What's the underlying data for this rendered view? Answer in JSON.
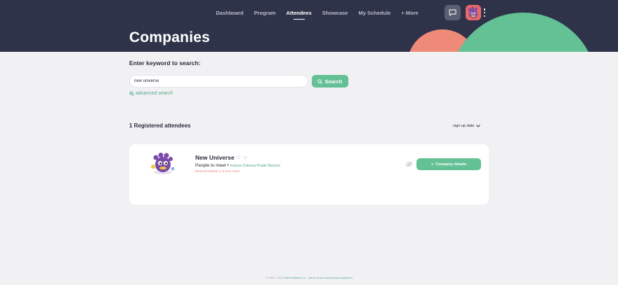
{
  "nav": {
    "items": [
      {
        "label": "Dashboard",
        "active": false
      },
      {
        "label": "Program",
        "active": false
      },
      {
        "label": "Attendees",
        "active": true
      },
      {
        "label": "Showcase",
        "active": false
      },
      {
        "label": "My Schedule",
        "active": false
      },
      {
        "label": "+ More",
        "active": false
      }
    ]
  },
  "header": {
    "title": "Companies",
    "chat_icon": "chat-icon",
    "menu_icon": "kebab-menu-icon"
  },
  "search": {
    "label": "Enter keyword to search:",
    "value": "new universe",
    "button_label": "Search",
    "advanced_label": "advanced search"
  },
  "results": {
    "count_label": "1 Registered attendees",
    "sort_label": "sign-up date"
  },
  "card": {
    "name": "New Universe",
    "people_prefix": "People to meet •",
    "people_names": "Ivanne Zulema Prado Barrios",
    "registered": "REGISTERED 3 DAYS AGO",
    "details_label": "Company details",
    "details_prefix": "+"
  },
  "footer": {
    "copyright": "© 2009 - 2022",
    "company": "MeetToMatch b.v.",
    "separator": "-",
    "terms": "terms of use and privacy statement"
  },
  "colors": {
    "header_bg": "#2f3349",
    "accent_green": "#64c195",
    "accent_salmon": "#f08a78",
    "link_green": "#5aa889"
  }
}
